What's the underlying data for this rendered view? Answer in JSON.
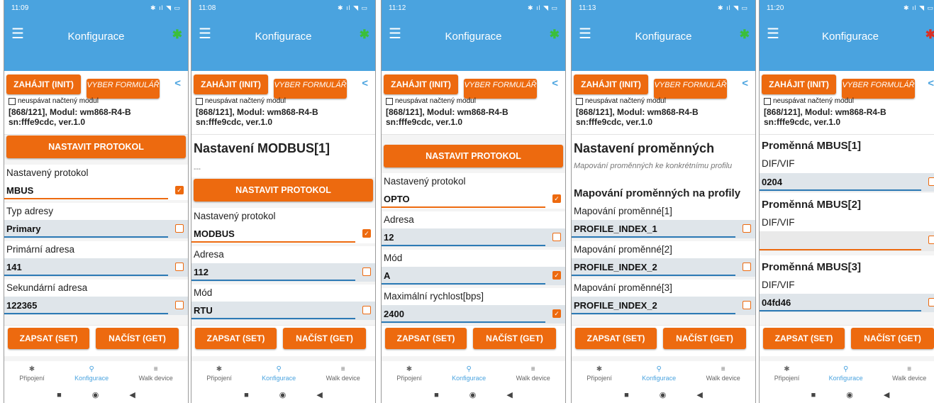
{
  "app": {
    "title": "Konfigurace",
    "init_button": "ZAHÁJIT (INIT)",
    "vyber_button": "VYBER FORMULÁŘ",
    "checkbox_label": "neuspávat načtený modul",
    "module_line1": "[868/121], Modul: wm868-R4-B",
    "module_line2": "sn:fffe9cdc, ver.1.0",
    "set_protocol": "NASTAVIT PROTOKOL",
    "set_button": "ZAPSAT (SET)",
    "get_button": "NAČÍST (GET)",
    "nav": [
      "Připojení",
      "Konfigurace",
      "Walk device"
    ],
    "colors": {
      "accent": "#4aa3df",
      "orange": "#ed6a0f",
      "bt_connected": "#3bbf3b",
      "bt_disconnected": "#d93025"
    }
  },
  "screens": [
    {
      "time": "11:09",
      "bluetooth": "connected",
      "texts": {
        "proto_btn": "NASTAVIT PROTOKOL",
        "l1": "Nastavený protokol",
        "v1": "MBUS",
        "l2": "Typ adresy",
        "v2": "Primary",
        "l3": "Primární adresa",
        "v3": "141",
        "l4": "Sekundární adresa",
        "v4": "122365"
      }
    },
    {
      "time": "11:08",
      "bluetooth": "connected",
      "texts": {
        "h": "Nastavení MODBUS[1]",
        "dash": "---",
        "proto_btn": "NASTAVIT PROTOKOL",
        "l1": "Nastavený protokol",
        "v1": "MODBUS",
        "l2": "Adresa",
        "v2": "112",
        "l3": "Mód",
        "v3": "RTU"
      }
    },
    {
      "time": "11:12",
      "bluetooth": "connected",
      "texts": {
        "proto_btn": "NASTAVIT PROTOKOL",
        "l1": "Nastavený protokol",
        "v1": "OPTO",
        "l2": "Adresa",
        "v2": "12",
        "l3": "Mód",
        "v3": "A",
        "l4": "Maximální rychlost[bps]",
        "v4": "2400"
      }
    },
    {
      "time": "11:13",
      "bluetooth": "connected",
      "texts": {
        "h": "Nastavení proměnných",
        "desc": "Mapování proměnných ke konkrétnímu profilu",
        "h3": "Mapování proměnných na profily",
        "l1": "Mapování proměnné[1]",
        "v1": "PROFILE_INDEX_1",
        "l2": "Mapování proměnné[2]",
        "v2": "PROFILE_INDEX_2",
        "l3": "Mapování proměnné[3]",
        "v3": "PROFILE_INDEX_2"
      }
    },
    {
      "time": "11:20",
      "bluetooth": "disconnected",
      "texts": {
        "h1": "Proměnná MBUS[1]",
        "l1": "DIF/VIF",
        "v1": "0204",
        "h2": "Proměnná MBUS[2]",
        "l2": "DIF/VIF",
        "v2": "",
        "h3": "Proměnná MBUS[3]",
        "l3": "DIF/VIF",
        "v3": "04fd46"
      }
    }
  ]
}
